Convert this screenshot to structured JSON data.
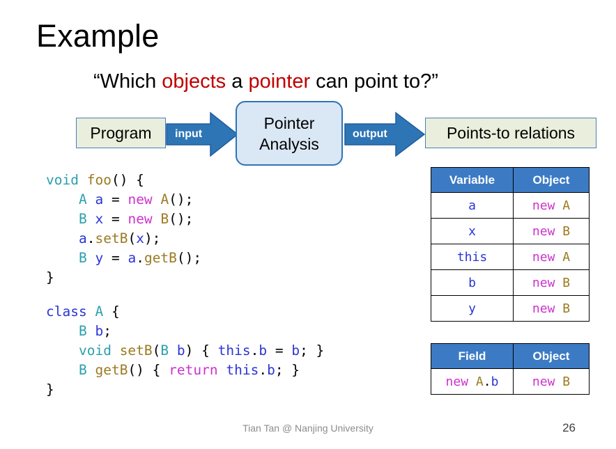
{
  "slide": {
    "title": "Example",
    "subtitle": {
      "pre": "“Which ",
      "hl1": "objects",
      "mid": " a ",
      "hl2": "pointer",
      "post": " can point to?”",
      "highlight_color": "#c00000"
    }
  },
  "pipeline": {
    "input_box_label": "Program",
    "input_arrow_label": "input",
    "analysis_line1": "Pointer",
    "analysis_line2": "Analysis",
    "output_arrow_label": "output",
    "output_box_label": "Points-to relations",
    "box_fill": "#e9efdc",
    "box_border": "#4a7ebb",
    "analysis_fill": "#dae7f5",
    "analysis_border": "#2e74b5",
    "arrow_fill": "#2e75b6",
    "arrow_border": "#1f5c9c"
  },
  "code": {
    "foo": {
      "lines": [
        [
          {
            "t": "void",
            "c": "kw-void"
          },
          {
            "t": " ",
            "c": "punc"
          },
          {
            "t": "foo",
            "c": "meth"
          },
          {
            "t": "() {",
            "c": "punc"
          }
        ],
        [
          {
            "t": "    ",
            "c": "punc"
          },
          {
            "t": "A",
            "c": "type"
          },
          {
            "t": " ",
            "c": "punc"
          },
          {
            "t": "a",
            "c": "var"
          },
          {
            "t": " = ",
            "c": "punc"
          },
          {
            "t": "new",
            "c": "kw-new"
          },
          {
            "t": " ",
            "c": "punc"
          },
          {
            "t": "A",
            "c": "meth"
          },
          {
            "t": "();",
            "c": "punc"
          }
        ],
        [
          {
            "t": "    ",
            "c": "punc"
          },
          {
            "t": "B",
            "c": "type"
          },
          {
            "t": " ",
            "c": "punc"
          },
          {
            "t": "x",
            "c": "var"
          },
          {
            "t": " = ",
            "c": "punc"
          },
          {
            "t": "new",
            "c": "kw-new"
          },
          {
            "t": " ",
            "c": "punc"
          },
          {
            "t": "B",
            "c": "meth"
          },
          {
            "t": "();",
            "c": "punc"
          }
        ],
        [
          {
            "t": "    ",
            "c": "punc"
          },
          {
            "t": "a",
            "c": "var"
          },
          {
            "t": ".",
            "c": "punc"
          },
          {
            "t": "setB",
            "c": "meth"
          },
          {
            "t": "(",
            "c": "punc"
          },
          {
            "t": "x",
            "c": "var"
          },
          {
            "t": ");",
            "c": "punc"
          }
        ],
        [
          {
            "t": "    ",
            "c": "punc"
          },
          {
            "t": "B",
            "c": "type"
          },
          {
            "t": " ",
            "c": "punc"
          },
          {
            "t": "y",
            "c": "var"
          },
          {
            "t": " = ",
            "c": "punc"
          },
          {
            "t": "a",
            "c": "var"
          },
          {
            "t": ".",
            "c": "punc"
          },
          {
            "t": "getB",
            "c": "meth"
          },
          {
            "t": "();",
            "c": "punc"
          }
        ],
        [
          {
            "t": "}",
            "c": "punc"
          }
        ]
      ]
    },
    "klass": {
      "lines": [
        [
          {
            "t": "class",
            "c": "kw-class"
          },
          {
            "t": " ",
            "c": "punc"
          },
          {
            "t": "A",
            "c": "type"
          },
          {
            "t": " {",
            "c": "punc"
          }
        ],
        [
          {
            "t": "    ",
            "c": "punc"
          },
          {
            "t": "B",
            "c": "type"
          },
          {
            "t": " ",
            "c": "punc"
          },
          {
            "t": "b",
            "c": "var"
          },
          {
            "t": ";",
            "c": "punc"
          }
        ],
        [
          {
            "t": "    ",
            "c": "punc"
          },
          {
            "t": "void",
            "c": "kw-void"
          },
          {
            "t": " ",
            "c": "punc"
          },
          {
            "t": "setB",
            "c": "meth"
          },
          {
            "t": "(",
            "c": "punc"
          },
          {
            "t": "B",
            "c": "type"
          },
          {
            "t": " ",
            "c": "punc"
          },
          {
            "t": "b",
            "c": "var"
          },
          {
            "t": ") { ",
            "c": "punc"
          },
          {
            "t": "this",
            "c": "var"
          },
          {
            "t": ".",
            "c": "punc"
          },
          {
            "t": "b",
            "c": "var"
          },
          {
            "t": " = ",
            "c": "punc"
          },
          {
            "t": "b",
            "c": "var"
          },
          {
            "t": "; }",
            "c": "punc"
          }
        ],
        [
          {
            "t": "    ",
            "c": "punc"
          },
          {
            "t": "B",
            "c": "type"
          },
          {
            "t": " ",
            "c": "punc"
          },
          {
            "t": "getB",
            "c": "meth"
          },
          {
            "t": "() { ",
            "c": "punc"
          },
          {
            "t": "return",
            "c": "kw-return"
          },
          {
            "t": " ",
            "c": "punc"
          },
          {
            "t": "this",
            "c": "var"
          },
          {
            "t": ".",
            "c": "punc"
          },
          {
            "t": "b",
            "c": "var"
          },
          {
            "t": "; }",
            "c": "punc"
          }
        ],
        [
          {
            "t": "}",
            "c": "punc"
          }
        ]
      ]
    }
  },
  "tables": {
    "points_to": {
      "headers": [
        "Variable",
        "Object"
      ],
      "rows": [
        [
          [
            {
              "t": "a",
              "c": "var"
            }
          ],
          [
            {
              "t": "new",
              "c": "kw-new"
            },
            {
              "t": " ",
              "c": "punc"
            },
            {
              "t": "A",
              "c": "meth"
            }
          ]
        ],
        [
          [
            {
              "t": "x",
              "c": "var"
            }
          ],
          [
            {
              "t": "new",
              "c": "kw-new"
            },
            {
              "t": " ",
              "c": "punc"
            },
            {
              "t": "B",
              "c": "meth"
            }
          ]
        ],
        [
          [
            {
              "t": "this",
              "c": "var"
            }
          ],
          [
            {
              "t": "new",
              "c": "kw-new"
            },
            {
              "t": " ",
              "c": "punc"
            },
            {
              "t": "A",
              "c": "meth"
            }
          ]
        ],
        [
          [
            {
              "t": "b",
              "c": "var"
            }
          ],
          [
            {
              "t": "new",
              "c": "kw-new"
            },
            {
              "t": " ",
              "c": "punc"
            },
            {
              "t": "B",
              "c": "meth"
            }
          ]
        ],
        [
          [
            {
              "t": "y",
              "c": "var"
            }
          ],
          [
            {
              "t": "new",
              "c": "kw-new"
            },
            {
              "t": " ",
              "c": "punc"
            },
            {
              "t": "B",
              "c": "meth"
            }
          ]
        ]
      ]
    },
    "field": {
      "headers": [
        "Field",
        "Object"
      ],
      "rows": [
        [
          [
            {
              "t": "new",
              "c": "kw-new"
            },
            {
              "t": " ",
              "c": "punc"
            },
            {
              "t": "A",
              "c": "meth"
            },
            {
              "t": ".",
              "c": "punc"
            },
            {
              "t": "b",
              "c": "var"
            }
          ],
          [
            {
              "t": "new",
              "c": "kw-new"
            },
            {
              "t": " ",
              "c": "punc"
            },
            {
              "t": "B",
              "c": "meth"
            }
          ]
        ]
      ]
    },
    "header_fill": "#3c7bc4"
  },
  "footer": {
    "credit": "Tian Tan @ Nanjing University",
    "page_number": "26"
  }
}
